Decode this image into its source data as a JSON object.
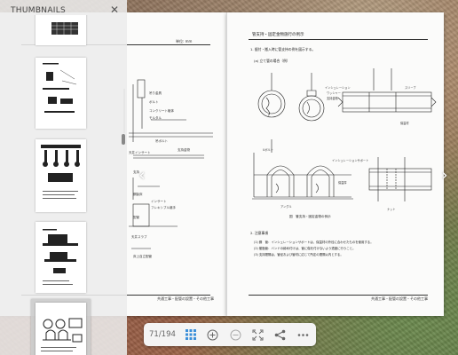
{
  "thumbnails_panel": {
    "title": "THUMBNAILS",
    "close_icon": "close-icon"
  },
  "left_page": {
    "header_right": "単位: mm",
    "labels": [
      "吊り金具",
      "ボルト",
      "コンクリート躯体",
      "モルタル",
      "吊ボルト",
      "支持金物",
      "天井インサート",
      "支持",
      "鋼製床",
      "インサート",
      "フレキシブル継手",
      "配管",
      "天井スラブ",
      "床上自立配管"
    ],
    "footer": "共通工事・配管の設置・その他工事"
  },
  "right_page": {
    "title": "管支持・固定金物施行の例示",
    "section_1": "1. 据付・搬入時に管支持の例を図示する。",
    "section_a": "(a) 立て管の場合（例）",
    "figure_caption": "図　管支持・固定金物の例示",
    "section_2": "2. 注意事項",
    "notes": [
      "(1) 鋼　管：インシュレーションサポートは、保温材の外径に合わせたものを使用する。",
      "(2) 樹脂管：バンドの締め付けは、管に傷を付けないよう適度に行うこと。",
      "(3) 支持間隔は、管径および管材に応じて所定の間隔以内とする。"
    ],
    "annotations": [
      "インシュレーション",
      "ワッシャー",
      "支持金物",
      "スリーブ",
      "保温材",
      "インシュレーションサポート",
      "Uボルト",
      "保温厚",
      "アングル",
      "ナット"
    ],
    "footer": "共通工事・配管の設置・その他工事"
  },
  "toolbar": {
    "page_counter": "71/194",
    "buttons": [
      "thumbnails-icon",
      "zoom-in-icon",
      "zoom-out-icon",
      "fullscreen-icon",
      "share-icon",
      "more-icon"
    ]
  },
  "navigation": {
    "prev_icon": "chevron-left-icon",
    "next_icon": "chevron-right-icon"
  },
  "colors": {
    "accent": "#3b8fd9",
    "panel_bg": "#ececec",
    "toolbar_bg": "#f4f4f4"
  }
}
